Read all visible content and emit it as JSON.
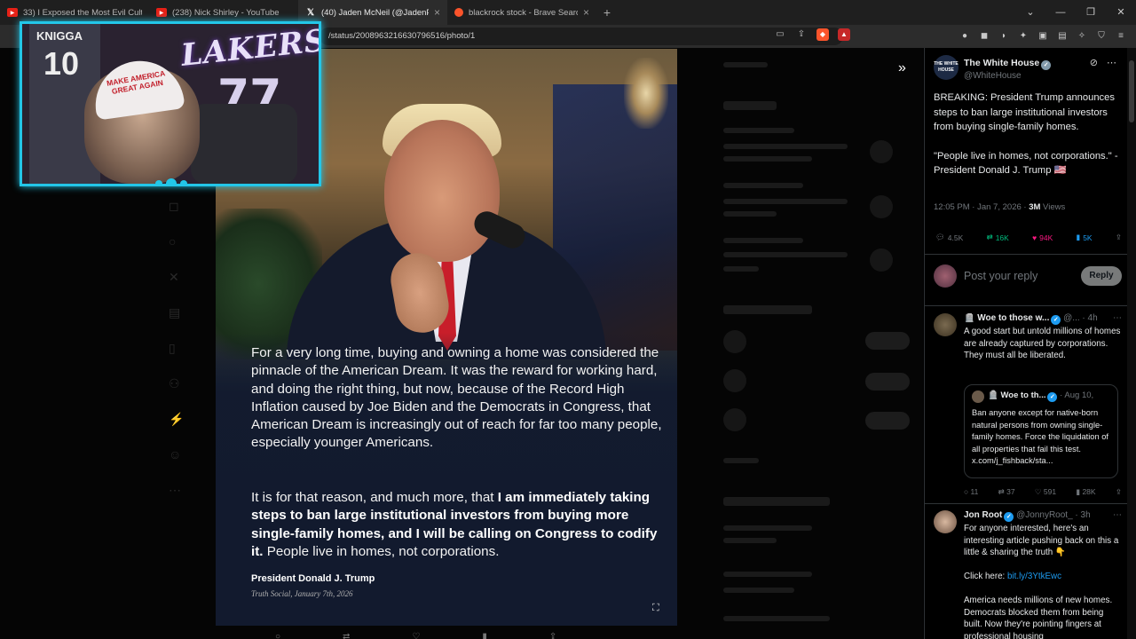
{
  "browser": {
    "tabs": [
      {
        "title": "33) I Exposed the Most Evil Cult in",
        "icon": "youtube-icon"
      },
      {
        "title": "(238) Nick Shirley - YouTube",
        "icon": "youtube-icon"
      },
      {
        "title": "(40) Jaden McNeil (@JadenPMc",
        "icon": "x-icon"
      },
      {
        "title": "blackrock stock - Brave Search",
        "icon": "brave-icon"
      }
    ],
    "url": "/status/2008963216630796516/photo/1"
  },
  "webcam": {
    "banner_text": "LAKERS",
    "banner_number": "77",
    "jersey_name": "KNIGGA",
    "jersey_number": "10",
    "hat_text": "MAKE AMERICA GREAT AGAIN"
  },
  "photo": {
    "quote_paragraph1": "For a very long time, buying and owning a home was considered the pinnacle of the American Dream. It was the reward for working hard, and doing the right thing, but now, because of the Record High Inflation caused by Joe Biden and the Democrats in Congress, that American Dream is increasingly out of reach for far too many people, especially younger Americans.",
    "quote_paragraph2_start": "It is for that reason, and much more, that ",
    "quote_paragraph2_bold": "I am immediately taking steps to ban large institutional investors from buying more single-family homes, and I will be calling on Congress to codify it.",
    "quote_paragraph2_end": " People live in homes, not corporations.",
    "signature_name": "President Donald J. Trump",
    "signature_source": "Truth Social, January 7th, 2026"
  },
  "tweet": {
    "author_name": "The White House",
    "author_handle": "@WhiteHouse",
    "logo_text": "THE WHITE HOUSE",
    "body1": "BREAKING: President Trump announces steps to ban large institutional investors from buying single-family homes.",
    "body2": "\"People live in homes, not corporations.\" - President Donald J. Trump 🇺🇸",
    "time": "12:05 PM · Jan 7, 2026 · ",
    "views_count": "3M",
    "views_label": " Views",
    "replies": "4.5K",
    "reposts": "16K",
    "likes": "94K",
    "bookmarks": "5K"
  },
  "reply_box": {
    "placeholder": "Post your reply",
    "button_label": "Reply"
  },
  "replies": [
    {
      "name": "Woe to those w...",
      "handle": "@... · 4h",
      "text": "A good start but untold millions of homes are already captured by corporations. They must all be liberated.",
      "quote_name": "Woe to th...",
      "quote_date": "· Aug 10,",
      "quote_text": "Ban anyone except for native-born natural persons from owning single-family homes. Force the liquidation of all properties that fail this test. x.com/j_fishback/sta...",
      "stats": {
        "replies": "11",
        "reposts": "37",
        "likes": "591",
        "views": "28K"
      }
    },
    {
      "name": "Jon Root",
      "handle": "@JonnyRoot_ · 3h",
      "text1": "For anyone interested, here's an interesting article pushing back on this a little & sharing the truth 👇",
      "link_prefix": "Click here: ",
      "link": "bit.ly/3YtkEwc",
      "text2": "America needs millions of new homes. Democrats blocked them from being built. Now they're pointing fingers at professional housing"
    }
  ]
}
